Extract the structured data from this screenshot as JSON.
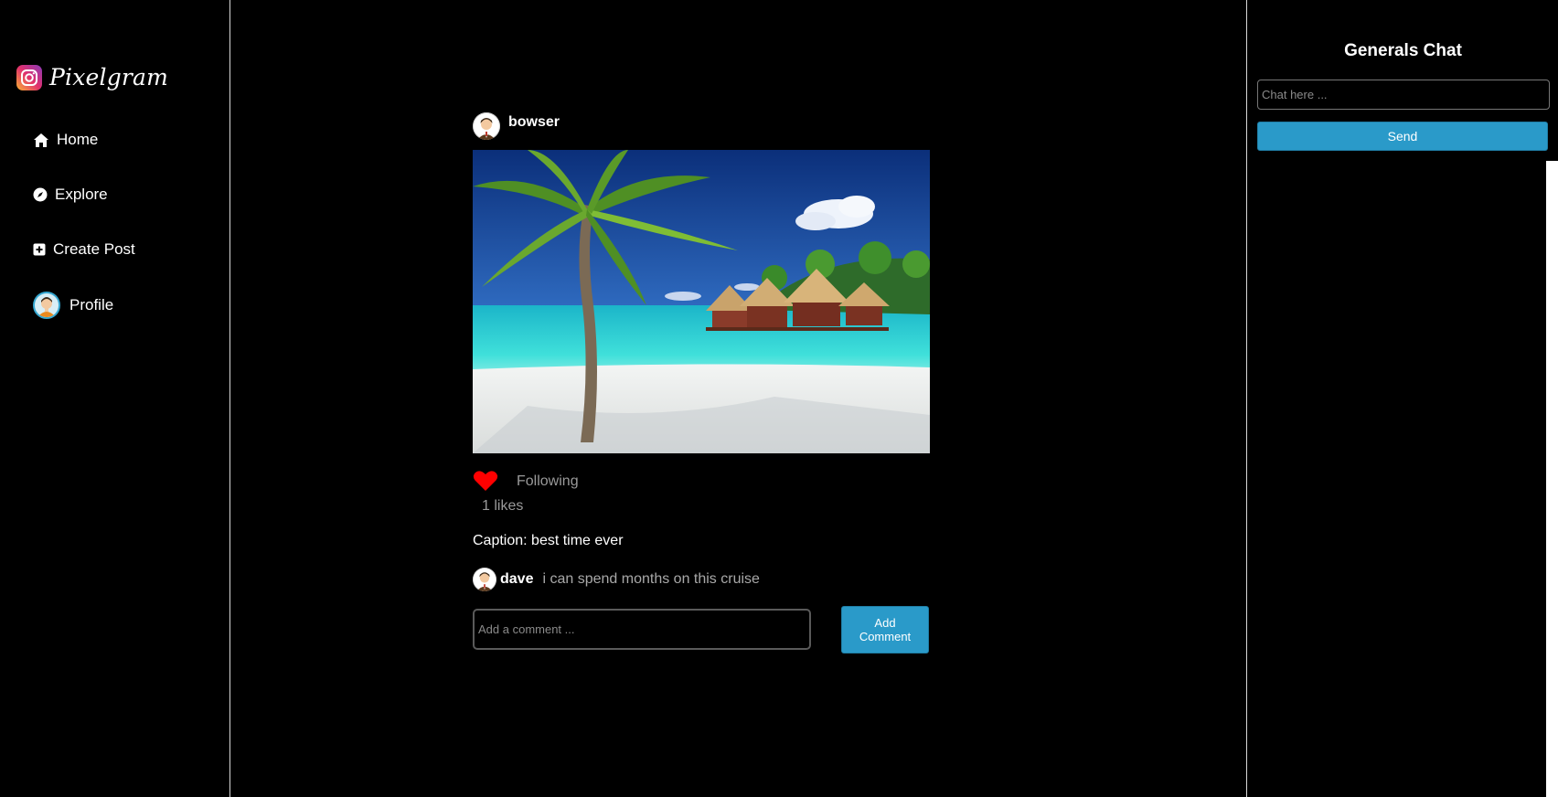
{
  "brand": {
    "name": "Pixelgram",
    "logo_icon": "instagram-logo-icon"
  },
  "nav": {
    "items": [
      {
        "label": "Home",
        "icon": "home-icon"
      },
      {
        "label": "Explore",
        "icon": "compass-icon"
      },
      {
        "label": "Create Post",
        "icon": "plus-square-icon"
      },
      {
        "label": "Profile",
        "icon": "avatar"
      }
    ]
  },
  "post": {
    "username": "bowser",
    "image_alt": "tropical-beach-photo",
    "liked": true,
    "follow_label": "Following",
    "likes_text": "1 likes",
    "caption": "Caption: best time ever",
    "comments": [
      {
        "user": "dave",
        "text": "i can spend months on this cruise"
      }
    ],
    "comment_placeholder": "Add a comment ...",
    "add_comment_label": "Add Comment"
  },
  "chat": {
    "title": "Generals Chat",
    "placeholder": "Chat here ...",
    "send_label": "Send"
  },
  "colors": {
    "background": "#000000",
    "accent": "#2a9ac9",
    "heart": "#ff0000",
    "muted_text": "#9a9a9a"
  }
}
